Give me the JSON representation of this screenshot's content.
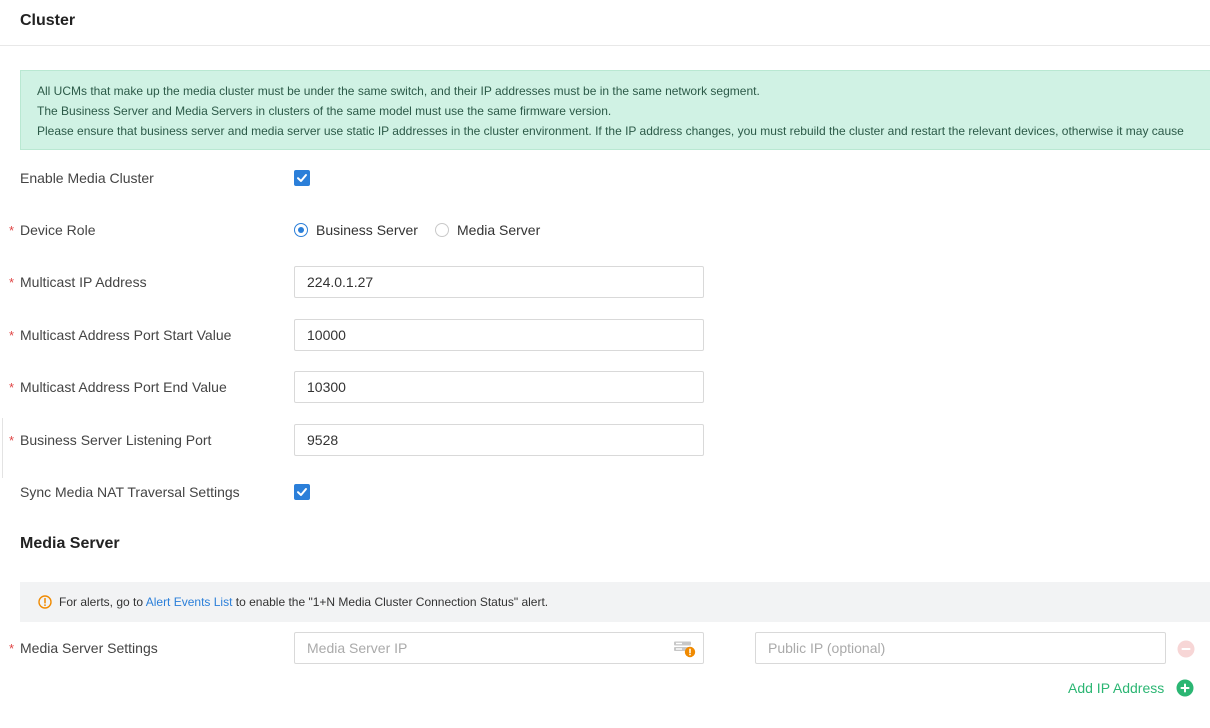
{
  "header": {
    "title": "Cluster"
  },
  "notice": {
    "lines": [
      "All UCMs that make up the media cluster must be under the same switch, and their IP addresses must be in the same network segment.",
      "The Business Server and Media Servers in clusters of the same model must use the same firmware version.",
      "Please ensure that business server and media server use static IP addresses in the cluster environment. If the IP address changes, you must rebuild the cluster and restart the relevant devices, otherwise it may cause"
    ]
  },
  "form": {
    "enable_media_cluster": {
      "label": "Enable Media Cluster",
      "checked": true
    },
    "device_role": {
      "label": "Device Role",
      "required_mark": "*",
      "options": [
        "Business Server",
        "Media Server"
      ],
      "selected": "Business Server"
    },
    "multicast_ip": {
      "label": "Multicast IP Address",
      "required_mark": "*",
      "value": "224.0.1.27"
    },
    "port_start": {
      "label": "Multicast Address Port Start Value",
      "required_mark": "*",
      "value": "10000"
    },
    "port_end": {
      "label": "Multicast Address Port End Value",
      "required_mark": "*",
      "value": "10300"
    },
    "listening_port": {
      "label": "Business Server Listening Port",
      "required_mark": "*",
      "value": "9528"
    },
    "sync_nat": {
      "label": "Sync Media NAT Traversal Settings",
      "checked": true
    }
  },
  "media_server": {
    "title": "Media Server",
    "alert": {
      "prefix": "For alerts, go to ",
      "link": "Alert Events List",
      "suffix": " to enable the \"1+N Media Cluster Connection Status\" alert."
    },
    "settings": {
      "label": "Media Server Settings",
      "required_mark": "*",
      "ip_placeholder": "Media Server IP",
      "public_ip_placeholder": "Public IP (optional)"
    },
    "add_ip_label": "Add IP Address"
  },
  "icons": {
    "checkbox": "checkmark-icon",
    "alert": "info-circle-icon",
    "ip": "ip-warning-icon",
    "remove": "minus-circle-icon",
    "add": "plus-circle-icon"
  },
  "colors": {
    "accent_blue": "#2b7fd9",
    "accent_green": "#2bb673",
    "notice_bg": "#d0f2e4",
    "required_red": "#e04545",
    "alert_orange": "#f08a00"
  }
}
